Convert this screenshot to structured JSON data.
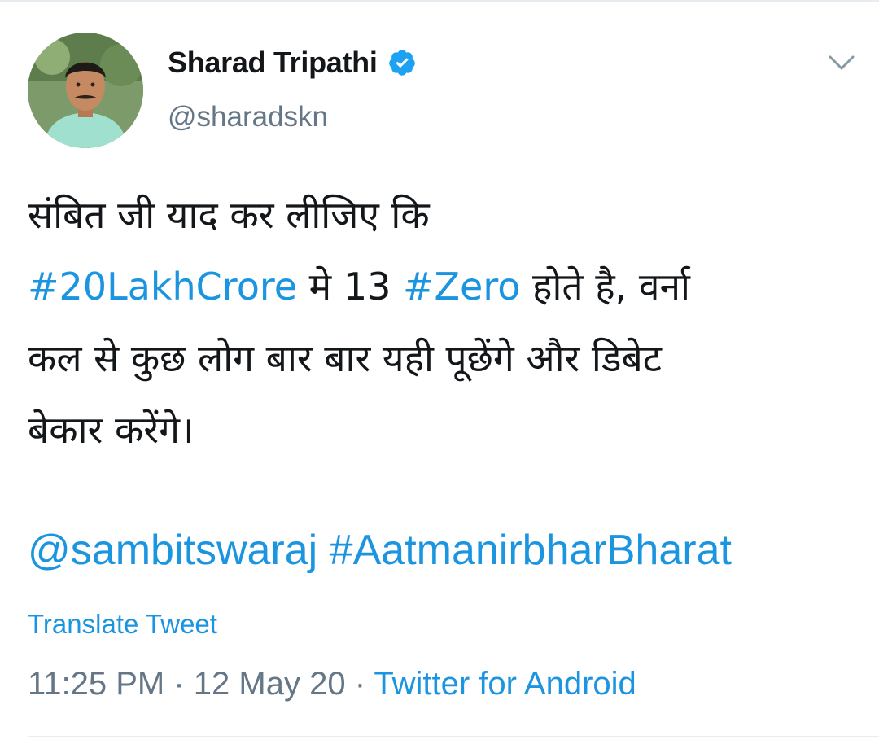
{
  "author": {
    "display_name": "Sharad Tripathi",
    "handle": "@sharadskn",
    "verified": true
  },
  "tweet": {
    "line1": "संबित जी याद कर लीजिए कि",
    "line2_tag1": "#20LakhCrore",
    "line2_text1": " मे 13 ",
    "line2_tag2": "#Zero",
    "line2_text2": " होते है, वर्ना",
    "line3": "कल से कुछ लोग बार बार यही पूछेंगे और डिबेट",
    "line4": "बेकार करेंगे।",
    "mention": "@sambitswaraj",
    "hashtag": "#AatmanirbharBharat"
  },
  "translate_label": "Translate Tweet",
  "meta": {
    "time": "11:25 PM",
    "separator": " · ",
    "date": "12 May 20",
    "source": "Twitter for Android"
  },
  "icons": {
    "verified": "verified-badge-icon",
    "menu": "chevron-down-icon"
  },
  "colors": {
    "link": "#1b95e0",
    "secondary": "#657786",
    "text": "#14171a",
    "verified": "#1da1f2"
  }
}
